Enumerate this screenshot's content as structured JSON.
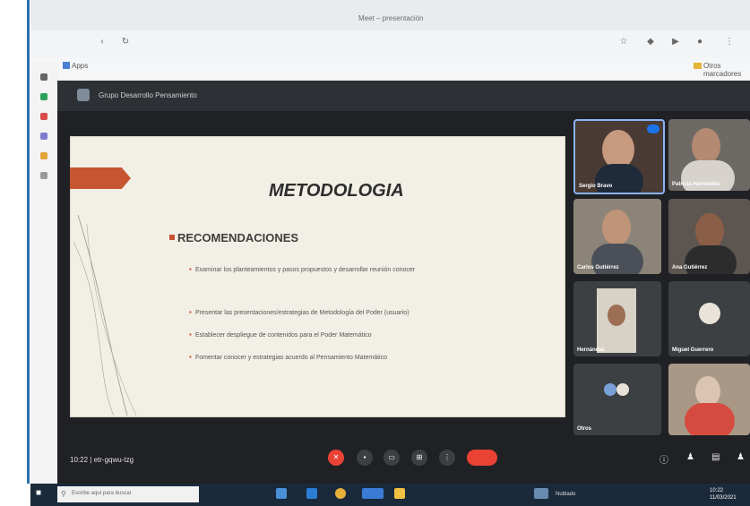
{
  "browser": {
    "tab_title": "Meet – presentación",
    "bookmarks": {
      "apps_label": "Apps",
      "other_label": "Otros marcadores"
    }
  },
  "meet": {
    "meeting_title": "Grupo Desarrollo Pensamiento",
    "time": "10:22",
    "separator": "|",
    "code": "etr-gqwu-tzg"
  },
  "slide": {
    "title": "METODOLOGIA",
    "subtitle": "RECOMENDACIONES",
    "bullets": [
      "Examinar los planteamientos y pasos propuestos y desarrollar reunión conocer",
      "Presentar las presentaciones/estrategias de Metodología del Poder (usuario)",
      "Establecer despliegue de contenidos para el Poder Matemático",
      "Fomentar conocer y estrategias acuerdo al Pensamiento Matemático"
    ]
  },
  "participants": [
    {
      "name": "Sergio Bravo"
    },
    {
      "name": "Patricia Hernández"
    },
    {
      "name": "Carlos Gutiérrez"
    },
    {
      "name": "Ana Gutiérrez"
    },
    {
      "name": "Hernández"
    },
    {
      "name": "Miguel Guerrero"
    },
    {
      "name": "Otros"
    },
    {
      "name": ""
    }
  ],
  "taskbar": {
    "search_placeholder": "Escribe aquí para buscar",
    "tray_text": "Nublado",
    "time": "10:22",
    "date": "11/03/2021"
  }
}
